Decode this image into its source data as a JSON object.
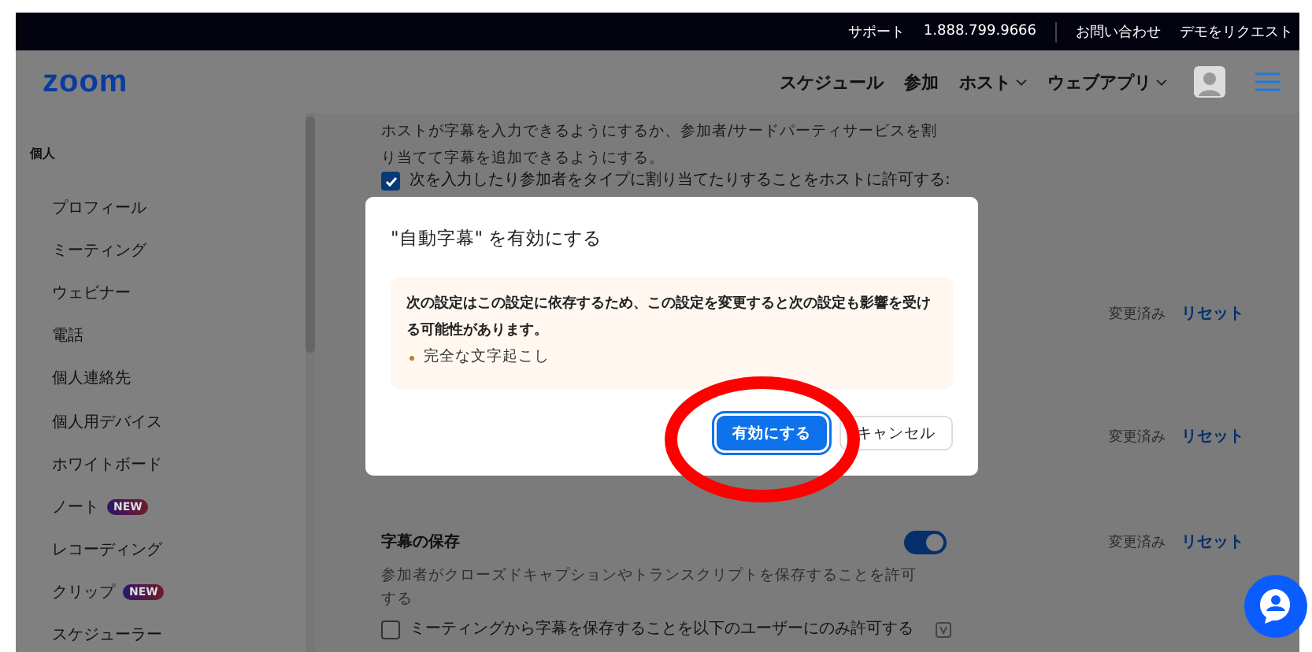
{
  "top_bar": {
    "links": [
      "サポート",
      "1.888.799.9666",
      "お問い合わせ",
      "デモをリクエスト"
    ]
  },
  "nav": {
    "logo": "zoom",
    "items": [
      {
        "label": "スケジュール",
        "dropdown": false
      },
      {
        "label": "参加",
        "dropdown": false
      },
      {
        "label": "ホスト",
        "dropdown": true
      },
      {
        "label": "ウェブアプリ",
        "dropdown": true
      }
    ]
  },
  "sidebar": {
    "section": "個人",
    "items": [
      {
        "label": "プロフィール"
      },
      {
        "label": "ミーティング"
      },
      {
        "label": "ウェビナー"
      },
      {
        "label": "電話"
      },
      {
        "label": "個人連絡先"
      },
      {
        "label": "個人用デバイス"
      },
      {
        "label": "ホワイトボード"
      },
      {
        "label": "ノート",
        "badge": "NEW"
      },
      {
        "label": "レコーディング"
      },
      {
        "label": "クリップ",
        "badge": "NEW"
      },
      {
        "label": "スケジューラー"
      }
    ]
  },
  "settings": {
    "description": "ホストが字幕を入力できるようにするか、参加者/サードパーティサービスを割り当てて字幕を追加できるようにする。",
    "host_checkbox": {
      "label": "次を入力したり参加者をタイプに割り当てたりすることをホストに許可する:",
      "checked": true
    },
    "status_rows": [
      {
        "status": "変更済み",
        "action": "リセット"
      },
      {
        "status": "変更済み",
        "action": "リセット"
      }
    ],
    "save_captions": {
      "title": "字幕の保存",
      "on": true,
      "description": "参加者がクローズドキャプションやトランスクリプトを保存することを許可する",
      "status": "変更済み",
      "action": "リセット",
      "checkbox": {
        "label": "ミーティングから字幕を保存することを以下のユーザーにのみ許可する",
        "checked": false
      }
    }
  },
  "dialog": {
    "title": "\"自動字幕\" を有効にする",
    "notice": "次の設定はこの設定に依存するため、この設定を変更すると次の設定も影響を受ける可能性があります。",
    "items": [
      "完全な文字起こし"
    ],
    "buttons": [
      {
        "label": "有効にする",
        "kind": "primary"
      },
      {
        "label": "キャンセル",
        "kind": "secondary"
      }
    ]
  }
}
